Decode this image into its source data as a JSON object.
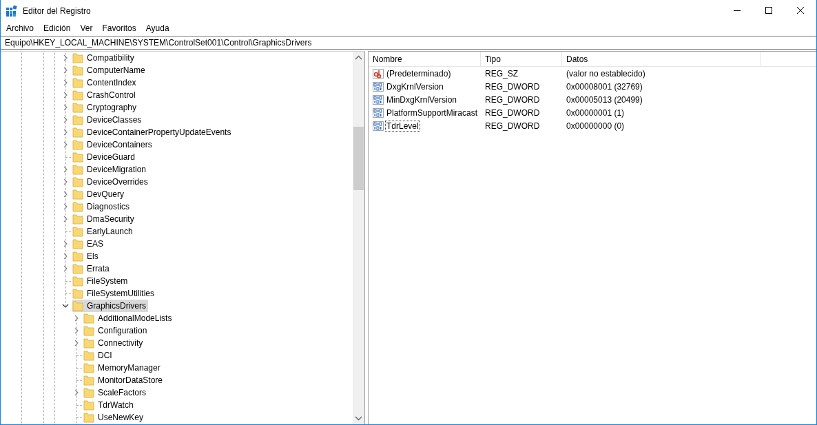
{
  "window": {
    "title": "Editor del Registro"
  },
  "menu": [
    "Archivo",
    "Edición",
    "Ver",
    "Favoritos",
    "Ayuda"
  ],
  "address": "Equipo\\HKEY_LOCAL_MACHINE\\SYSTEM\\ControlSet001\\Control\\GraphicsDrivers",
  "tree": [
    {
      "label": "Compatibility",
      "expandable": true,
      "selected": false
    },
    {
      "label": "ComputerName",
      "expandable": true,
      "selected": false
    },
    {
      "label": "ContentIndex",
      "expandable": true,
      "selected": false
    },
    {
      "label": "CrashControl",
      "expandable": true,
      "selected": false
    },
    {
      "label": "Cryptography",
      "expandable": true,
      "selected": false
    },
    {
      "label": "DeviceClasses",
      "expandable": true,
      "selected": false
    },
    {
      "label": "DeviceContainerPropertyUpdateEvents",
      "expandable": true,
      "selected": false
    },
    {
      "label": "DeviceContainers",
      "expandable": true,
      "selected": false
    },
    {
      "label": "DeviceGuard",
      "expandable": false,
      "selected": false
    },
    {
      "label": "DeviceMigration",
      "expandable": true,
      "selected": false
    },
    {
      "label": "DeviceOverrides",
      "expandable": true,
      "selected": false
    },
    {
      "label": "DevQuery",
      "expandable": true,
      "selected": false
    },
    {
      "label": "Diagnostics",
      "expandable": true,
      "selected": false
    },
    {
      "label": "DmaSecurity",
      "expandable": true,
      "selected": false
    },
    {
      "label": "EarlyLaunch",
      "expandable": false,
      "selected": false
    },
    {
      "label": "EAS",
      "expandable": true,
      "selected": false
    },
    {
      "label": "Els",
      "expandable": true,
      "selected": false
    },
    {
      "label": "Errata",
      "expandable": true,
      "selected": false
    },
    {
      "label": "FileSystem",
      "expandable": false,
      "selected": false
    },
    {
      "label": "FileSystemUtilities",
      "expandable": false,
      "selected": false
    },
    {
      "label": "GraphicsDrivers",
      "expandable": true,
      "expanded": true,
      "selected": true,
      "children": [
        {
          "label": "AdditionalModeLists",
          "expandable": true,
          "selected": false
        },
        {
          "label": "Configuration",
          "expandable": true,
          "selected": false
        },
        {
          "label": "Connectivity",
          "expandable": true,
          "selected": false
        },
        {
          "label": "DCI",
          "expandable": false,
          "selected": false
        },
        {
          "label": "MemoryManager",
          "expandable": false,
          "selected": false
        },
        {
          "label": "MonitorDataStore",
          "expandable": false,
          "selected": false
        },
        {
          "label": "ScaleFactors",
          "expandable": true,
          "selected": false
        },
        {
          "label": "TdrWatch",
          "expandable": false,
          "selected": false
        },
        {
          "label": "UseNewKey",
          "expandable": false,
          "selected": false
        }
      ]
    }
  ],
  "values": {
    "columns": [
      "Nombre",
      "Tipo",
      "Datos"
    ],
    "rows": [
      {
        "kind": "string",
        "name": "(Predeterminado)",
        "type": "REG_SZ",
        "data": "(valor no establecido)",
        "selected": false
      },
      {
        "kind": "binary",
        "name": "DxgKrnlVersion",
        "type": "REG_DWORD",
        "data": "0x00008001 (32769)",
        "selected": false
      },
      {
        "kind": "binary",
        "name": "MinDxgKrnlVersion",
        "type": "REG_DWORD",
        "data": "0x00005013 (20499)",
        "selected": false
      },
      {
        "kind": "binary",
        "name": "PlatformSupportMiracast",
        "type": "REG_DWORD",
        "data": "0x00000001 (1)",
        "selected": false
      },
      {
        "kind": "binary",
        "name": "TdrLevel",
        "type": "REG_DWORD",
        "data": "0x00000000 (0)",
        "selected": true
      }
    ]
  }
}
